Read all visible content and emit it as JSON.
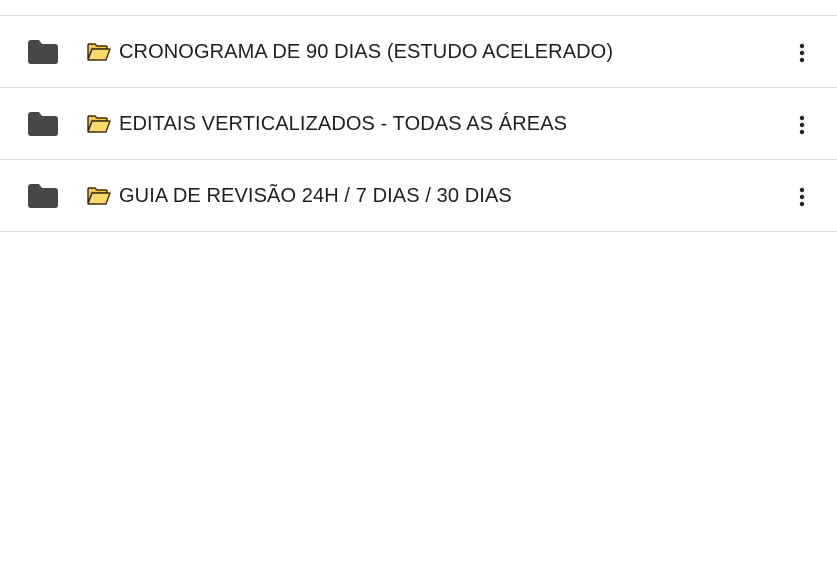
{
  "folders": [
    {
      "name": "CRONOGRAMA DE 90 DIAS (ESTUDO ACELERADO)",
      "icon": "folder-icon",
      "emoji": "open-file-folder-icon",
      "menu_icon": "more-vert-icon"
    },
    {
      "name": "EDITAIS VERTICALIZADOS - TODAS AS ÁREAS",
      "icon": "folder-icon",
      "emoji": "open-file-folder-icon",
      "menu_icon": "more-vert-icon"
    },
    {
      "name": "GUIA DE REVISÃO 24H / 7 DIAS / 30 DIAS",
      "icon": "folder-icon",
      "emoji": "open-file-folder-icon",
      "menu_icon": "more-vert-icon"
    }
  ],
  "colors": {
    "folder_icon": "#444746",
    "emoji_folder_fill": "#fcd86b",
    "emoji_folder_outline": "#3c2f14",
    "text": "#202124",
    "divider": "#dadce0",
    "background": "#ffffff"
  }
}
